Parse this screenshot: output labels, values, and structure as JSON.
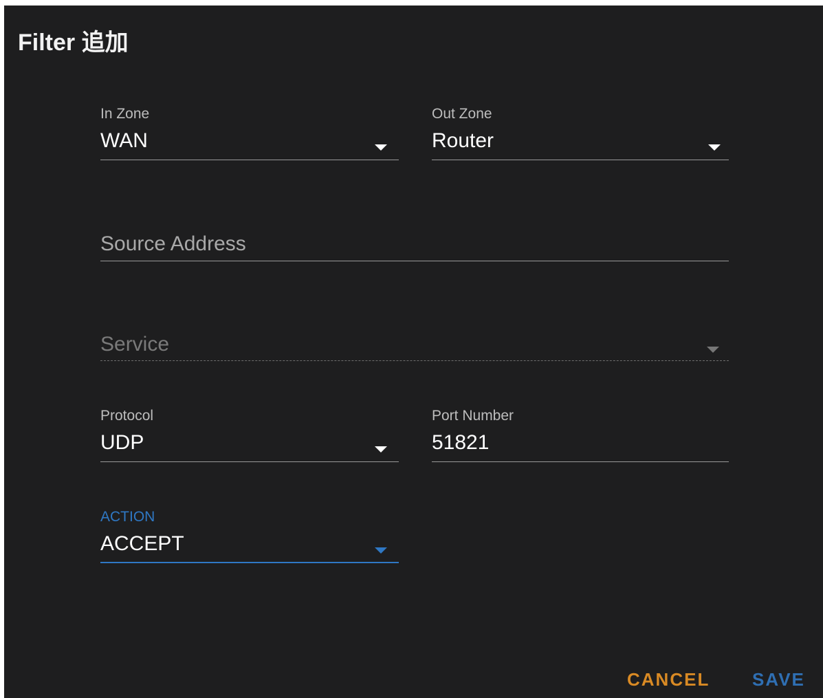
{
  "dialog": {
    "title": "Filter 追加"
  },
  "fields": {
    "in_zone": {
      "label": "In Zone",
      "value": "WAN"
    },
    "out_zone": {
      "label": "Out Zone",
      "value": "Router"
    },
    "source_address": {
      "placeholder": "Source Address"
    },
    "service": {
      "placeholder": "Service"
    },
    "protocol": {
      "label": "Protocol",
      "value": "UDP"
    },
    "port_number": {
      "label": "Port Number",
      "value": "51821"
    },
    "action": {
      "label": "ACTION",
      "value": "ACCEPT"
    }
  },
  "buttons": {
    "cancel": "CANCEL",
    "save": "SAVE"
  },
  "colors": {
    "background": "#1e1e1f",
    "accent_blue": "#2f78c4",
    "cancel_orange": "#d98a24"
  },
  "icons": {
    "dropdown": "chevron-down-icon"
  }
}
